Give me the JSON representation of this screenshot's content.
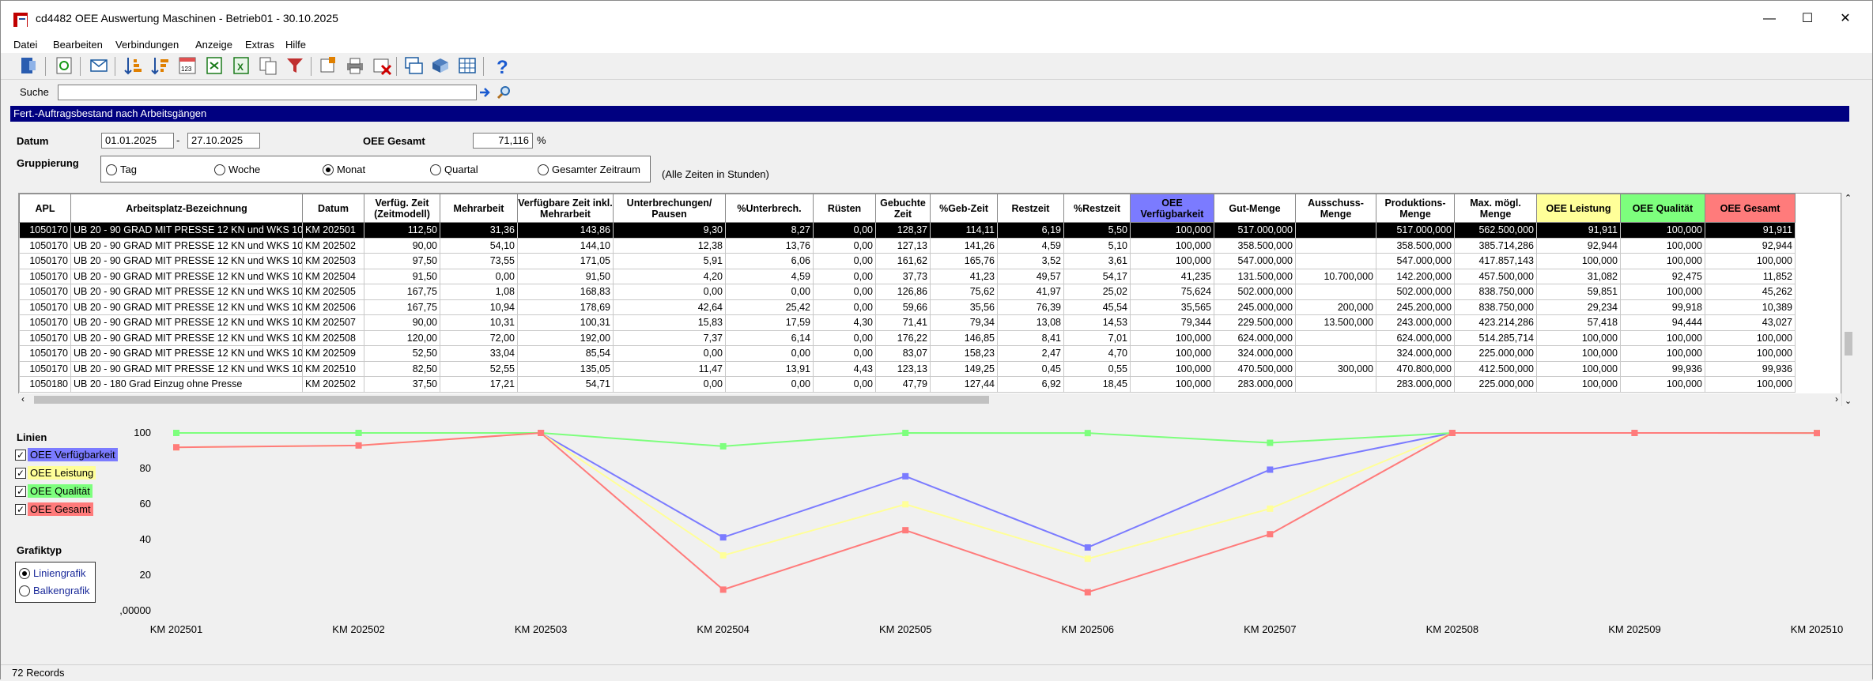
{
  "window": {
    "title": "cd4482 OEE Auswertung Maschinen - Betrieb01 - 30.10.2025",
    "controls": [
      "—",
      "☐",
      "✕"
    ]
  },
  "menu": [
    "Datei",
    "Bearbeiten",
    "Verbindungen",
    "Anzeige",
    "Extras",
    "Hilfe"
  ],
  "search": {
    "label": "Suche",
    "value": ""
  },
  "section": {
    "title": "Fert.-Auftragsbestand nach Arbeitsgängen"
  },
  "filter": {
    "datum_label": "Datum",
    "date_from": "01.01.2025",
    "date_sep": "-",
    "date_to": "27.10.2025",
    "oee_label": "OEE Gesamt",
    "oee_value": "71,116",
    "oee_unit": "%",
    "grouping_label": "Gruppierung",
    "grouping_options": [
      "Tag",
      "Woche",
      "Monat",
      "Quartal",
      "Gesamter Zeitraum"
    ],
    "grouping_selected": "Monat",
    "note": "(Alle Zeiten in Stunden)"
  },
  "table": {
    "columns": [
      "APL",
      "Arbeitsplatz-Bezeichnung",
      "Datum",
      "Verfüg. Zeit (Zeitmodell)",
      "Mehrarbeit",
      "Verfügbare Zeit inkl. Mehrarbeit",
      "Unterbrechungen/ Pausen",
      "%Unterbrech.",
      "Rüsten",
      "Gebuchte Zeit",
      "%Geb-Zeit",
      "Restzeit",
      "%Restzeit",
      "OEE Verfügbarkeit",
      "Gut-Menge",
      "Ausschuss-Menge",
      "Produktions-Menge",
      "Max. mögl. Menge",
      "OEE Leistung",
      "OEE Qualität",
      "OEE Gesamt"
    ],
    "header_colors": {
      "OEE Verfügbarkeit": "#7b7bff",
      "OEE Leistung": "#ffff99",
      "OEE Qualität": "#7dff7d",
      "OEE Gesamt": "#ff7b7b"
    },
    "rows": [
      [
        "1050170",
        "UB 20 - 90 GRAD MIT PRESSE 12 KN und WKS 10",
        "KM 202501",
        "112,50",
        "31,36",
        "143,86",
        "9,30",
        "8,27",
        "0,00",
        "128,37",
        "114,11",
        "6,19",
        "5,50",
        "100,000",
        "517.000,000",
        "",
        "517.000,000",
        "562.500,000",
        "91,911",
        "100,000",
        "91,911"
      ],
      [
        "1050170",
        "UB 20 - 90 GRAD MIT PRESSE 12 KN und WKS 10",
        "KM 202502",
        "90,00",
        "54,10",
        "144,10",
        "12,38",
        "13,76",
        "0,00",
        "127,13",
        "141,26",
        "4,59",
        "5,10",
        "100,000",
        "358.500,000",
        "",
        "358.500,000",
        "385.714,286",
        "92,944",
        "100,000",
        "92,944"
      ],
      [
        "1050170",
        "UB 20 - 90 GRAD MIT PRESSE 12 KN und WKS 10",
        "KM 202503",
        "97,50",
        "73,55",
        "171,05",
        "5,91",
        "6,06",
        "0,00",
        "161,62",
        "165,76",
        "3,52",
        "3,61",
        "100,000",
        "547.000,000",
        "",
        "547.000,000",
        "417.857,143",
        "100,000",
        "100,000",
        "100,000"
      ],
      [
        "1050170",
        "UB 20 - 90 GRAD MIT PRESSE 12 KN und WKS 10",
        "KM 202504",
        "91,50",
        "0,00",
        "91,50",
        "4,20",
        "4,59",
        "0,00",
        "37,73",
        "41,23",
        "49,57",
        "54,17",
        "41,235",
        "131.500,000",
        "10.700,000",
        "142.200,000",
        "457.500,000",
        "31,082",
        "92,475",
        "11,852"
      ],
      [
        "1050170",
        "UB 20 - 90 GRAD MIT PRESSE 12 KN und WKS 10",
        "KM 202505",
        "167,75",
        "1,08",
        "168,83",
        "0,00",
        "0,00",
        "0,00",
        "126,86",
        "75,62",
        "41,97",
        "25,02",
        "75,624",
        "502.000,000",
        "",
        "502.000,000",
        "838.750,000",
        "59,851",
        "100,000",
        "45,262"
      ],
      [
        "1050170",
        "UB 20 - 90 GRAD MIT PRESSE 12 KN und WKS 10",
        "KM 202506",
        "167,75",
        "10,94",
        "178,69",
        "42,64",
        "25,42",
        "0,00",
        "59,66",
        "35,56",
        "76,39",
        "45,54",
        "35,565",
        "245.000,000",
        "200,000",
        "245.200,000",
        "838.750,000",
        "29,234",
        "99,918",
        "10,389"
      ],
      [
        "1050170",
        "UB 20 - 90 GRAD MIT PRESSE 12 KN und WKS 10",
        "KM 202507",
        "90,00",
        "10,31",
        "100,31",
        "15,83",
        "17,59",
        "4,30",
        "71,41",
        "79,34",
        "13,08",
        "14,53",
        "79,344",
        "229.500,000",
        "13.500,000",
        "243.000,000",
        "423.214,286",
        "57,418",
        "94,444",
        "43,027"
      ],
      [
        "1050170",
        "UB 20 - 90 GRAD MIT PRESSE 12 KN und WKS 10",
        "KM 202508",
        "120,00",
        "72,00",
        "192,00",
        "7,37",
        "6,14",
        "0,00",
        "176,22",
        "146,85",
        "8,41",
        "7,01",
        "100,000",
        "624.000,000",
        "",
        "624.000,000",
        "514.285,714",
        "100,000",
        "100,000",
        "100,000"
      ],
      [
        "1050170",
        "UB 20 - 90 GRAD MIT PRESSE 12 KN und WKS 10",
        "KM 202509",
        "52,50",
        "33,04",
        "85,54",
        "0,00",
        "0,00",
        "0,00",
        "83,07",
        "158,23",
        "2,47",
        "4,70",
        "100,000",
        "324.000,000",
        "",
        "324.000,000",
        "225.000,000",
        "100,000",
        "100,000",
        "100,000"
      ],
      [
        "1050170",
        "UB 20 - 90 GRAD MIT PRESSE 12 KN und WKS 10",
        "KM 202510",
        "82,50",
        "52,55",
        "135,05",
        "11,47",
        "13,91",
        "4,43",
        "123,13",
        "149,25",
        "0,45",
        "0,55",
        "100,000",
        "470.500,000",
        "300,000",
        "470.800,000",
        "412.500,000",
        "100,000",
        "99,936",
        "99,936"
      ],
      [
        "1050180",
        "UB 20 - 180 Grad Einzug ohne Presse",
        "KM 202502",
        "37,50",
        "17,21",
        "54,71",
        "0,00",
        "0,00",
        "0,00",
        "47,79",
        "127,44",
        "6,92",
        "18,45",
        "100,000",
        "283.000,000",
        "",
        "283.000,000",
        "225.000,000",
        "100,000",
        "100,000",
        "100,000"
      ]
    ]
  },
  "legend": {
    "title": "Linien",
    "items": [
      {
        "label": "OEE Verfügbarkeit",
        "color": "#7b7bff",
        "checked": true
      },
      {
        "label": "OEE Leistung",
        "color": "#ffff99",
        "checked": true
      },
      {
        "label": "OEE Qualität",
        "color": "#7dff7d",
        "checked": true
      },
      {
        "label": "OEE Gesamt",
        "color": "#ff7b7b",
        "checked": true
      }
    ]
  },
  "charttype": {
    "title": "Grafiktyp",
    "options": [
      "Liniengrafik",
      "Balkengrafik"
    ],
    "selected": "Liniengrafik"
  },
  "chart_data": {
    "type": "line",
    "categories": [
      "KM 202501",
      "KM 202502",
      "KM 202503",
      "KM 202504",
      "KM 202505",
      "KM 202506",
      "KM 202507",
      "KM 202508",
      "KM 202509",
      "KM 202510"
    ],
    "ylim": [
      0,
      100
    ],
    "yticks": [
      "100",
      "80",
      "60",
      "40",
      "20",
      ",00000"
    ],
    "grid": false,
    "series": [
      {
        "name": "OEE Verfügbarkeit",
        "color": "#7b7bff",
        "values": [
          100,
          100,
          100,
          41.235,
          75.624,
          35.565,
          79.344,
          100,
          100,
          100
        ]
      },
      {
        "name": "OEE Leistung",
        "color": "#ffff99",
        "values": [
          91.911,
          92.944,
          100,
          31.082,
          59.851,
          29.234,
          57.418,
          100,
          100,
          100
        ]
      },
      {
        "name": "OEE Qualität",
        "color": "#7dff7d",
        "values": [
          100,
          100,
          100,
          92.475,
          100,
          99.918,
          94.444,
          100,
          100,
          99.936
        ]
      },
      {
        "name": "OEE Gesamt",
        "color": "#ff7b7b",
        "values": [
          91.911,
          92.944,
          100,
          11.852,
          45.262,
          10.389,
          43.027,
          100,
          100,
          99.936
        ]
      }
    ]
  },
  "status": {
    "records": "72 Records"
  }
}
